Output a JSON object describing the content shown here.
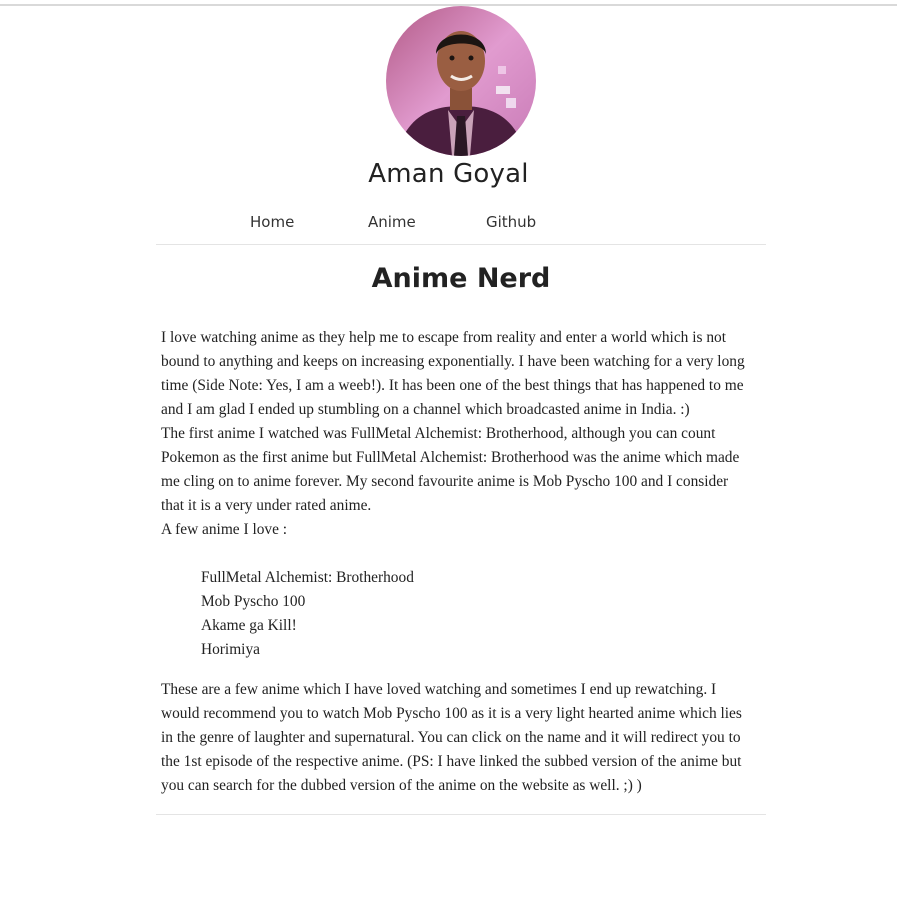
{
  "profile": {
    "name": "Aman Goyal",
    "avatar_alt": "profile-photo"
  },
  "nav": {
    "items": [
      {
        "label": "Home"
      },
      {
        "label": "Anime"
      },
      {
        "label": "Github"
      }
    ]
  },
  "main": {
    "title": "Anime Nerd",
    "intro_lines": [
      "I love watching anime as they help me to escape from reality and enter a world which is not",
      "bound to anything and keeps on increasing exponentially. I have been watching for a very long",
      "time (Side Note: Yes, I am a weeb!). It has been one of the best things that has happened to me",
      "and I am glad I ended up stumbling on a channel which broadcasted anime in India. :)"
    ],
    "first_anime_lines": [
      "The first anime I watched was FullMetal Alchemist: Brotherhood, although you can count",
      "Pokemon as the first anime but FullMetal Alchemist: Brotherhood was the anime which made",
      "me cling on to anime forever. My second favourite anime is Mob Pyscho 100 and I consider",
      "that it is a very under rated anime."
    ],
    "list_intro": "A few anime I love :",
    "anime_list": [
      "FullMetal Alchemist: Brotherhood",
      "Mob Pyscho 100",
      "Akame ga Kill!",
      "Horimiya"
    ],
    "outro_lines": [
      "These are a few anime which I have loved watching and sometimes I end up rewatching. I",
      "would recommend you to watch Mob Pyscho 100 as it is a very light hearted anime which lies",
      "in the genre of laughter and supernatural. You can click on the name and it will redirect you to",
      "the 1st episode of the respective anime. (PS: I have linked the subbed version of the anime but",
      "you can search for the dubbed version of the anime on the website as well. ;) )"
    ]
  }
}
